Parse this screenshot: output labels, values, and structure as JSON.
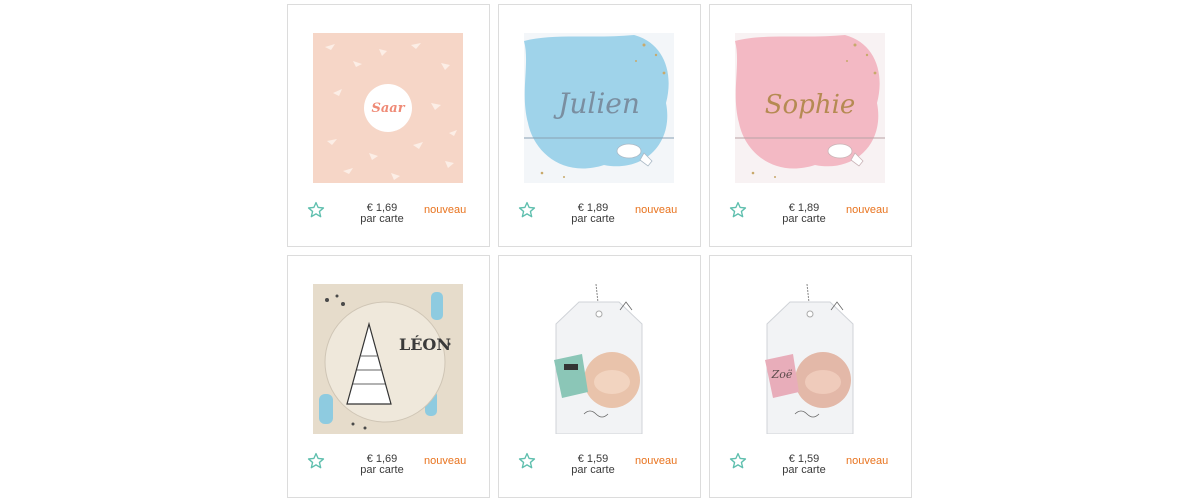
{
  "accent_color": "#5fbfae",
  "badge_color": "#e8731e",
  "products": [
    {
      "card_text": "Saar",
      "price": "€ 1,69",
      "unit": "par carte",
      "badge": "nouveau",
      "fav_icon": "star-outline-icon"
    },
    {
      "card_text": "Julien",
      "price": "€ 1,89",
      "unit": "par carte",
      "badge": "nouveau",
      "fav_icon": "star-outline-icon"
    },
    {
      "card_text": "Sophie",
      "price": "€ 1,89",
      "unit": "par carte",
      "badge": "nouveau",
      "fav_icon": "star-outline-icon"
    },
    {
      "card_text": "LÉON",
      "price": "€ 1,69",
      "unit": "par carte",
      "badge": "nouveau",
      "fav_icon": "star-outline-icon"
    },
    {
      "card_text": "",
      "price": "€ 1,59",
      "unit": "par carte",
      "badge": "nouveau",
      "fav_icon": "star-outline-icon"
    },
    {
      "card_text": "Zoë",
      "price": "€ 1,59",
      "unit": "par carte",
      "badge": "nouveau",
      "fav_icon": "star-outline-icon"
    }
  ]
}
